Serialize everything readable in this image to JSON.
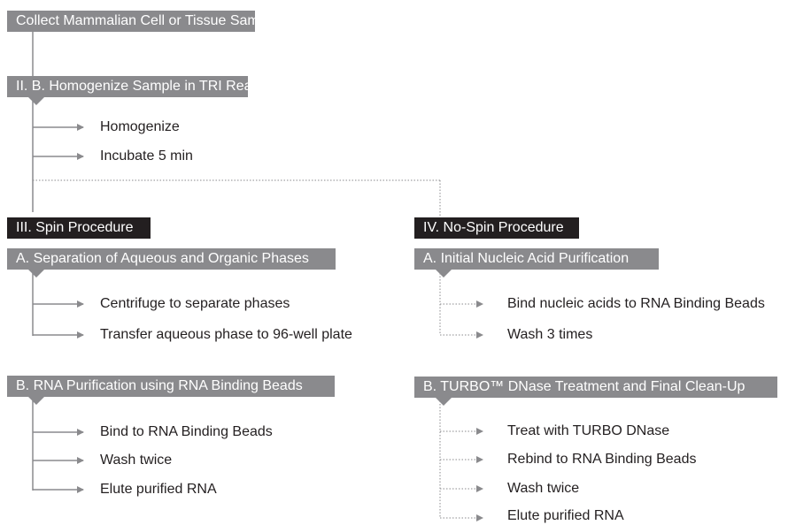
{
  "top_steps": {
    "collect": "Collect Mammalian Cell or Tissue Sample",
    "homogenize_header": "II. B. Homogenize Sample in TRI Reagent®",
    "sub_steps": [
      "Homogenize",
      "Incubate 5 min"
    ]
  },
  "spin": {
    "title": "III. Spin Procedure",
    "section_a": {
      "title": "A. Separation of Aqueous and Organic Phases",
      "steps": [
        "Centrifuge to separate phases",
        "Transfer aqueous phase to 96-well plate"
      ]
    },
    "section_b": {
      "title": "B. RNA Purification using RNA Binding Beads",
      "steps": [
        "Bind to RNA Binding Beads",
        "Wash twice",
        "Elute purified RNA"
      ]
    }
  },
  "no_spin": {
    "title": "IV. No-Spin Procedure",
    "section_a": {
      "title": "A. Initial Nucleic Acid Purification",
      "steps": [
        "Bind nucleic acids to RNA Binding Beads",
        "Wash 3 times"
      ]
    },
    "section_b": {
      "title": "B. TURBO™ DNase Treatment and Final Clean-Up",
      "steps": [
        "Treat with TURBO DNase",
        "Rebind to RNA Binding Beads",
        "Wash twice",
        "Elute purified RNA"
      ]
    }
  },
  "colors": {
    "box_gray": "#8a8a8d",
    "box_black": "#231f20",
    "line": "#8a8a8d"
  }
}
